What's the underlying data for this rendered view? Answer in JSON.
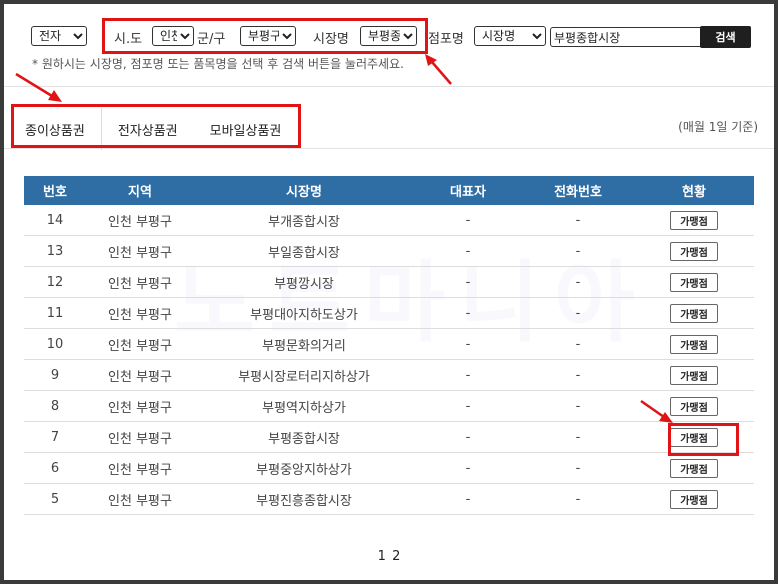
{
  "filters": {
    "type_value": "전자",
    "sido_label": "시.도",
    "sido_value": "인천",
    "gugun_label": "군/구",
    "gugun_value": "부평구",
    "market_label": "시장명",
    "market_value": "부평종합시장",
    "store_label": "점포명",
    "store_select_value": "시장명",
    "search_value": "부평종합시장",
    "search_button": "검색",
    "notice": "* 원하시는 시장명, 점포명 또는 품목명을 선택 후 검색 버튼을 눌러주세요."
  },
  "tabs": [
    "종이상품권",
    "전자상품권",
    "모바일상품권"
  ],
  "basis_note": "(매월 1일 기준)",
  "table": {
    "headers": [
      "번호",
      "지역",
      "시장명",
      "대표자",
      "전화번호",
      "현황"
    ],
    "rows": [
      {
        "no": "14",
        "region": "인천 부평구",
        "market": "부개종합시장",
        "rep": "-",
        "phone": "-",
        "status": "가맹점"
      },
      {
        "no": "13",
        "region": "인천 부평구",
        "market": "부일종합시장",
        "rep": "-",
        "phone": "-",
        "status": "가맹점"
      },
      {
        "no": "12",
        "region": "인천 부평구",
        "market": "부평깡시장",
        "rep": "-",
        "phone": "-",
        "status": "가맹점"
      },
      {
        "no": "11",
        "region": "인천 부평구",
        "market": "부평대아지하도상가",
        "rep": "-",
        "phone": "-",
        "status": "가맹점"
      },
      {
        "no": "10",
        "region": "인천 부평구",
        "market": "부평문화의거리",
        "rep": "-",
        "phone": "-",
        "status": "가맹점"
      },
      {
        "no": "9",
        "region": "인천 부평구",
        "market": "부평시장로터리지하상가",
        "rep": "-",
        "phone": "-",
        "status": "가맹점"
      },
      {
        "no": "8",
        "region": "인천 부평구",
        "market": "부평역지하상가",
        "rep": "-",
        "phone": "-",
        "status": "가맹점"
      },
      {
        "no": "7",
        "region": "인천 부평구",
        "market": "부평종합시장",
        "rep": "-",
        "phone": "-",
        "status": "가맹점"
      },
      {
        "no": "6",
        "region": "인천 부평구",
        "market": "부평중앙지하상가",
        "rep": "-",
        "phone": "-",
        "status": "가맹점"
      },
      {
        "no": "5",
        "region": "인천 부평구",
        "market": "부평진흥종합시장",
        "rep": "-",
        "phone": "-",
        "status": "가맹점"
      }
    ]
  },
  "pagination": [
    "1",
    "2"
  ],
  "watermark": "노트마니아",
  "colors": {
    "header": "#2f6ea5",
    "highlight": "#e01414",
    "search_button": "#1f1f1f"
  }
}
